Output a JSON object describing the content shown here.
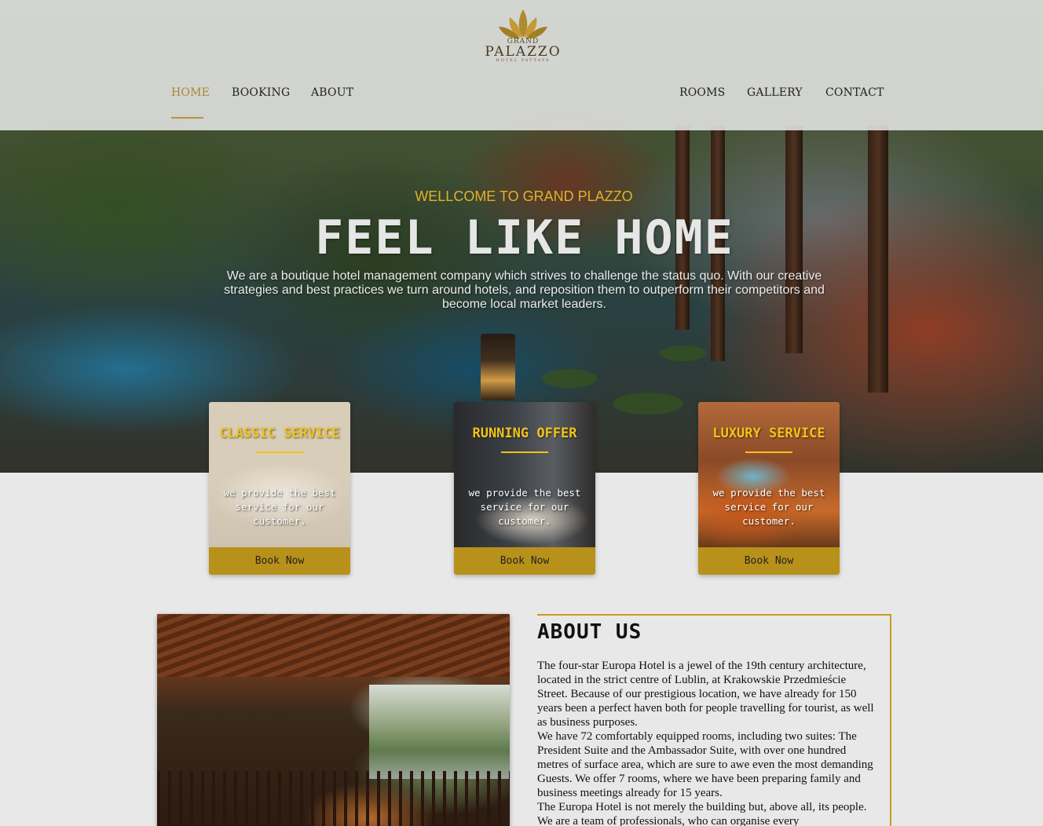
{
  "brand": {
    "logo_top": "GRAND",
    "logo_main": "PALAZZO",
    "logo_sub": "HOTEL PATTAYA"
  },
  "nav": {
    "left": [
      "HOME",
      "BOOKING",
      "ABOUT"
    ],
    "right": [
      "ROOMS",
      "GALLERY",
      "CONTACT"
    ],
    "active": "HOME"
  },
  "hero": {
    "welcome": "WELLCOME TO GRAND PLAZZO",
    "title": "FEEL LIKE HOME",
    "description": "We are a boutique hotel management company which strives to challenge the status quo. With our creative strategies and best practices we turn around hotels, and reposition them to outperform their competitors and become local market leaders."
  },
  "cards": [
    {
      "title": "CLASSIC SERVICE",
      "text": "we provide the best service for our customer.",
      "button": "Book Now",
      "image": "bedroom-photo"
    },
    {
      "title": "RUNNING OFFER",
      "text": "we provide the best service for our customer.",
      "button": "Book Now",
      "image": "suite-photo"
    },
    {
      "title": "LUXURY SERVICE",
      "text": "we provide the best service for our customer.",
      "button": "Book Now",
      "image": "spa-photo"
    }
  ],
  "about": {
    "title": "ABOUT US",
    "paragraphs": [
      "The four-star Europa Hotel is a jewel of the 19th century architecture, located in the strict centre of Lublin, at Krakowskie Przedmieście Street. Because of our prestigious location, we have already for 150 years been a perfect haven both for people travelling for tourist, as well as business purposes.",
      "We have 72 comfortably equipped rooms, including two suites: The President Suite and the Ambassador Suite, with over one hundred metres of surface area, which are sure to awe even the most demanding Guests. We offer 7 rooms, where we have been preparing family and business meetings already for 15 years.",
      "The Europa Hotel is not merely the building but, above all, its people. We are a team of professionals, who can organise every"
    ]
  },
  "colors": {
    "accent_gold": "#b8911a",
    "title_yellow": "#f2c318",
    "nav_active": "#a8872f",
    "page_bg": "#e8e8e8"
  }
}
